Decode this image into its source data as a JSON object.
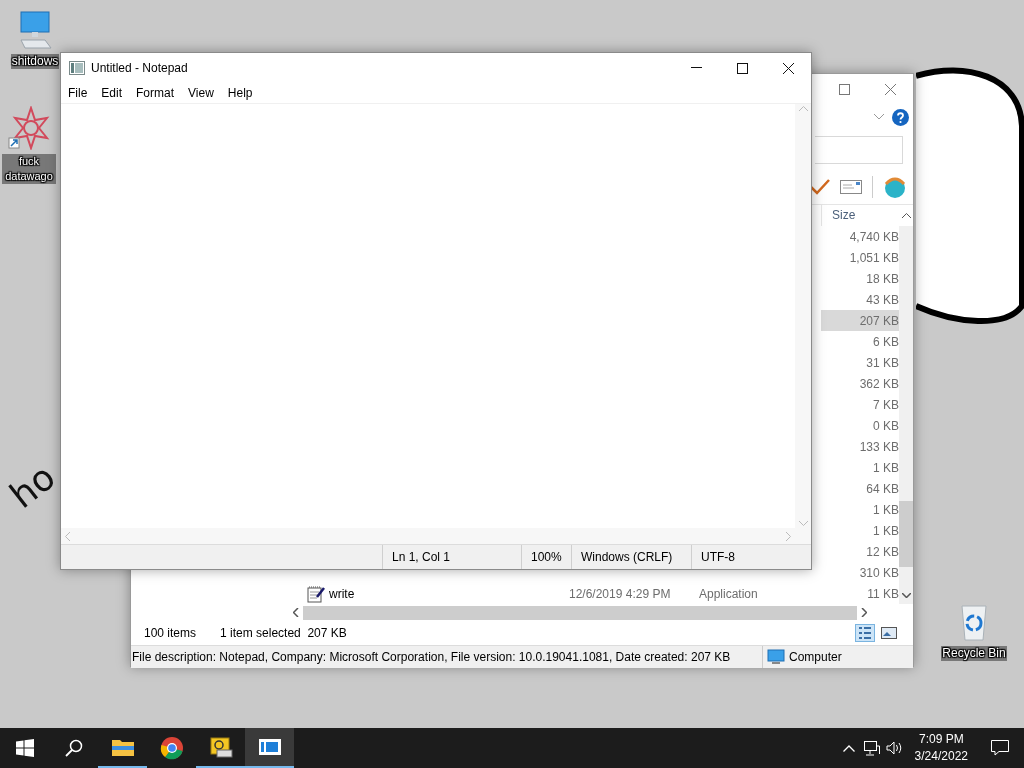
{
  "desktop": {
    "icons": [
      {
        "kind": "computer",
        "label": "shitdows"
      },
      {
        "kind": "shortcut",
        "label": "fuck datawago"
      },
      {
        "kind": "recycle-bin",
        "label": "Recycle Bin"
      }
    ],
    "wallpaper_text": "ho"
  },
  "explorer": {
    "size_column": "Size",
    "rows": [
      {
        "size": "4,740 KB",
        "selected": false
      },
      {
        "size": "1,051 KB",
        "selected": false
      },
      {
        "size": "18 KB",
        "selected": false
      },
      {
        "size": "43 KB",
        "selected": false
      },
      {
        "size": "207 KB",
        "selected": true
      },
      {
        "size": "6 KB",
        "selected": false
      },
      {
        "size": "31 KB",
        "selected": false
      },
      {
        "size": "362 KB",
        "selected": false
      },
      {
        "size": "7 KB",
        "selected": false
      },
      {
        "size": "0 KB",
        "selected": false
      },
      {
        "size": "133 KB",
        "selected": false
      },
      {
        "size": "1 KB",
        "selected": false
      },
      {
        "size": "64 KB",
        "selected": false
      },
      {
        "size": "1 KB",
        "selected": false
      },
      {
        "size": "1 KB",
        "selected": false
      },
      {
        "size": "12 KB",
        "selected": false
      },
      {
        "size": "310 KB",
        "selected": false
      },
      {
        "kind": "application",
        "name": "write",
        "date": "12/6/2019 4:29 PM",
        "type": "Application",
        "size": "11 KB",
        "selected": false
      }
    ],
    "status": {
      "item_count": "100 items",
      "selection": "1 item selected  207 KB"
    },
    "details_bar": {
      "description": "File description: Notepad, Company: Microsoft Corporation, File version: 10.0.19041.1081, Date created: 207 KB",
      "location": "Computer"
    }
  },
  "notepad": {
    "title": "Untitled - Notepad",
    "menu": [
      "File",
      "Edit",
      "Format",
      "View",
      "Help"
    ],
    "status": [
      "Ln 1, Col 1",
      "100%",
      "Windows (CRLF)",
      "UTF-8"
    ]
  },
  "taskbar": {
    "apps": [
      {
        "kind": "file-explorer",
        "running": true,
        "selected": false
      },
      {
        "kind": "browser",
        "running": false,
        "selected": false
      },
      {
        "kind": "mail",
        "running": true,
        "selected": false
      },
      {
        "kind": "notepad",
        "running": true,
        "selected": true
      }
    ],
    "clock": {
      "time": "7:09 PM",
      "date": "3/24/2022"
    }
  }
}
